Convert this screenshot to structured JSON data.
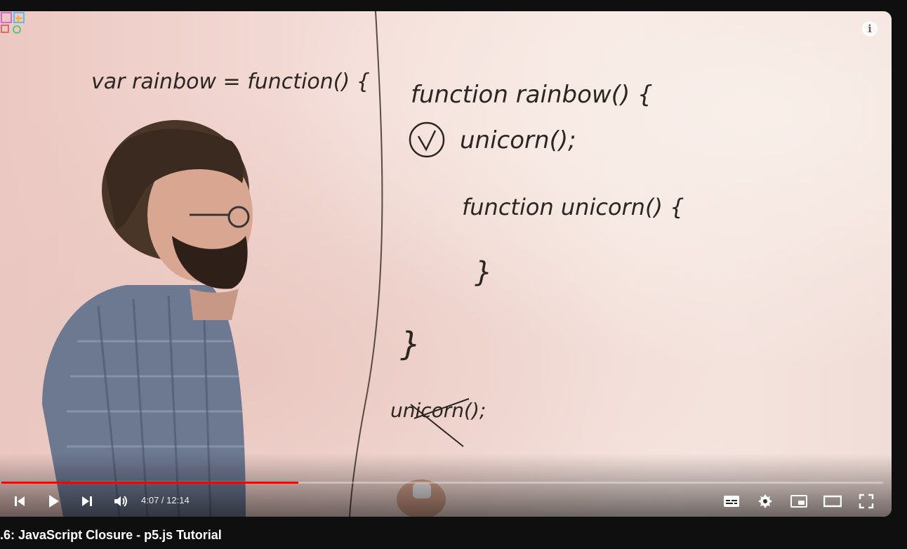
{
  "video": {
    "progress_fraction": 0.337,
    "current_time": "4:07",
    "duration": "12:14",
    "time_display": "4:07 / 12:14"
  },
  "whiteboard": {
    "left_code": "var rainbow = function() {",
    "right_line1": "function rainbow() {",
    "right_line2": "unicorn();",
    "right_line3": "function unicorn() {",
    "right_close_inner": "}",
    "right_close_outer": "}",
    "crossed_call": "unicorn();"
  },
  "controls": {
    "previous_icon": "skip-previous-icon",
    "play_icon": "play-icon",
    "next_icon": "skip-next-icon",
    "volume_icon": "volume-icon",
    "subtitles_icon": "subtitles-icon",
    "settings_icon": "gear-icon",
    "miniplayer_icon": "miniplayer-icon",
    "theater_icon": "theater-mode-icon",
    "fullscreen_icon": "fullscreen-icon"
  },
  "page": {
    "video_title": ".6: JavaScript Closure - p5.js Tutorial"
  },
  "colors": {
    "progress_played": "#ff0000",
    "page_background": "#0f0f0f"
  }
}
